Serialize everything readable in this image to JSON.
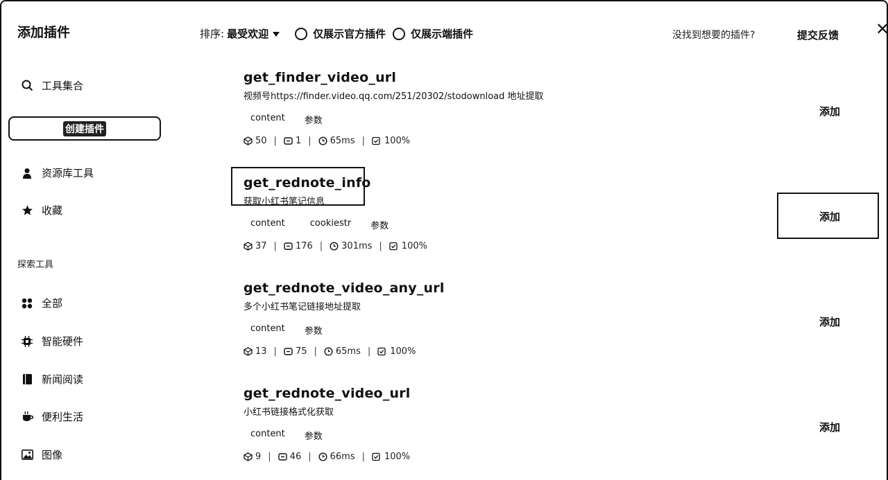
{
  "dialog": {
    "title": "添加插件",
    "sort_label": "排序:",
    "sort_value": "最受欢迎",
    "filter_official": "仅展示官方插件",
    "filter_client": "仅展示端插件",
    "help_text": "没找到想要的插件?",
    "feedback": "提交反馈",
    "close": "✕"
  },
  "sidebar": {
    "search_label": "工具集合",
    "create_button": "创建插件",
    "library": "资源库工具",
    "favorites": "收藏",
    "explore_label": "探索工具",
    "categories": [
      "全部",
      "智能硬件",
      "新闻阅读",
      "便利生活",
      "图像"
    ]
  },
  "plugins": [
    {
      "name": "get_finder_video_url",
      "desc": "视频号https://finder.video.qq.com/251/20302/stodownload 地址提取",
      "tags": [
        "content",
        "参数"
      ],
      "stats": {
        "users": "50",
        "calls": "1",
        "latency": "65ms",
        "success": "100%"
      },
      "add": "添加"
    },
    {
      "name": "get_rednote_info",
      "desc": "获取小红书笔记信息",
      "tags": [
        "content",
        "cookiestr",
        "参数"
      ],
      "stats": {
        "users": "37",
        "calls": "176",
        "latency": "301ms",
        "success": "100%"
      },
      "add": "添加"
    },
    {
      "name": "get_rednote_video_any_url",
      "desc": "多个小红书笔记链接地址提取",
      "tags": [
        "content",
        "参数"
      ],
      "stats": {
        "users": "13",
        "calls": "75",
        "latency": "65ms",
        "success": "100%"
      },
      "add": "添加"
    },
    {
      "name": "get_rednote_video_url",
      "desc": "小红书链接格式化获取",
      "tags": [
        "content",
        "参数"
      ],
      "stats": {
        "users": "9",
        "calls": "46",
        "latency": "66ms",
        "success": "100%"
      },
      "add": "添加"
    }
  ]
}
